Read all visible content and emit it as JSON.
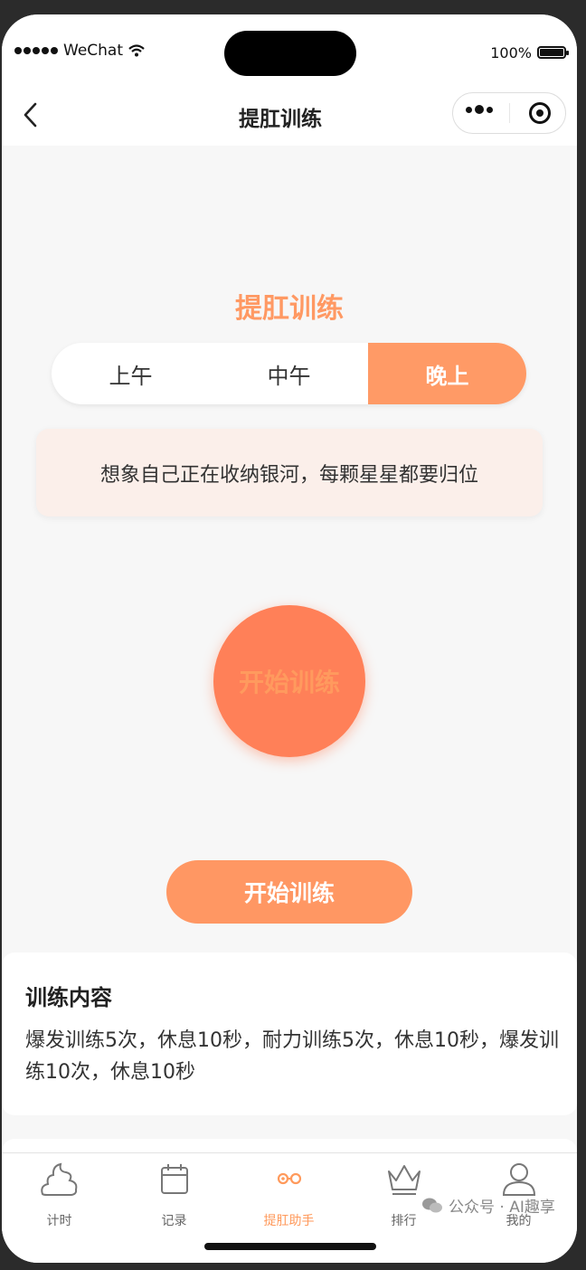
{
  "status_bar": {
    "carrier": "WeChat",
    "battery": "100%"
  },
  "nav": {
    "title": "提肛训练"
  },
  "main": {
    "heading": "提肛训练",
    "periods": [
      {
        "label": "上午",
        "active": false
      },
      {
        "label": "中午",
        "active": false
      },
      {
        "label": "晚上",
        "active": true
      }
    ],
    "tip": "想象自己正在收纳银河，每颗星星都要归位",
    "circle_label": "开始训练",
    "start_button": "开始训练"
  },
  "content_card": {
    "title": "训练内容",
    "text": "爆发训练5次，休息10秒，耐力训练5次，休息10秒，爆发训练10次，休息10秒"
  },
  "tabbar": {
    "items": [
      {
        "label": "计时",
        "icon": "poop-icon",
        "active": false
      },
      {
        "label": "记录",
        "icon": "calendar-icon",
        "active": false
      },
      {
        "label": "提肛助手",
        "icon": "link-icon",
        "active": true
      },
      {
        "label": "排行",
        "icon": "crown-icon",
        "active": false
      },
      {
        "label": "我的",
        "icon": "user-icon",
        "active": false
      }
    ]
  },
  "watermark": "公众号 · AI趣享",
  "colors": {
    "accent": "#ff9a66",
    "circle": "#ff8058",
    "tip_bg": "#fbefea"
  }
}
